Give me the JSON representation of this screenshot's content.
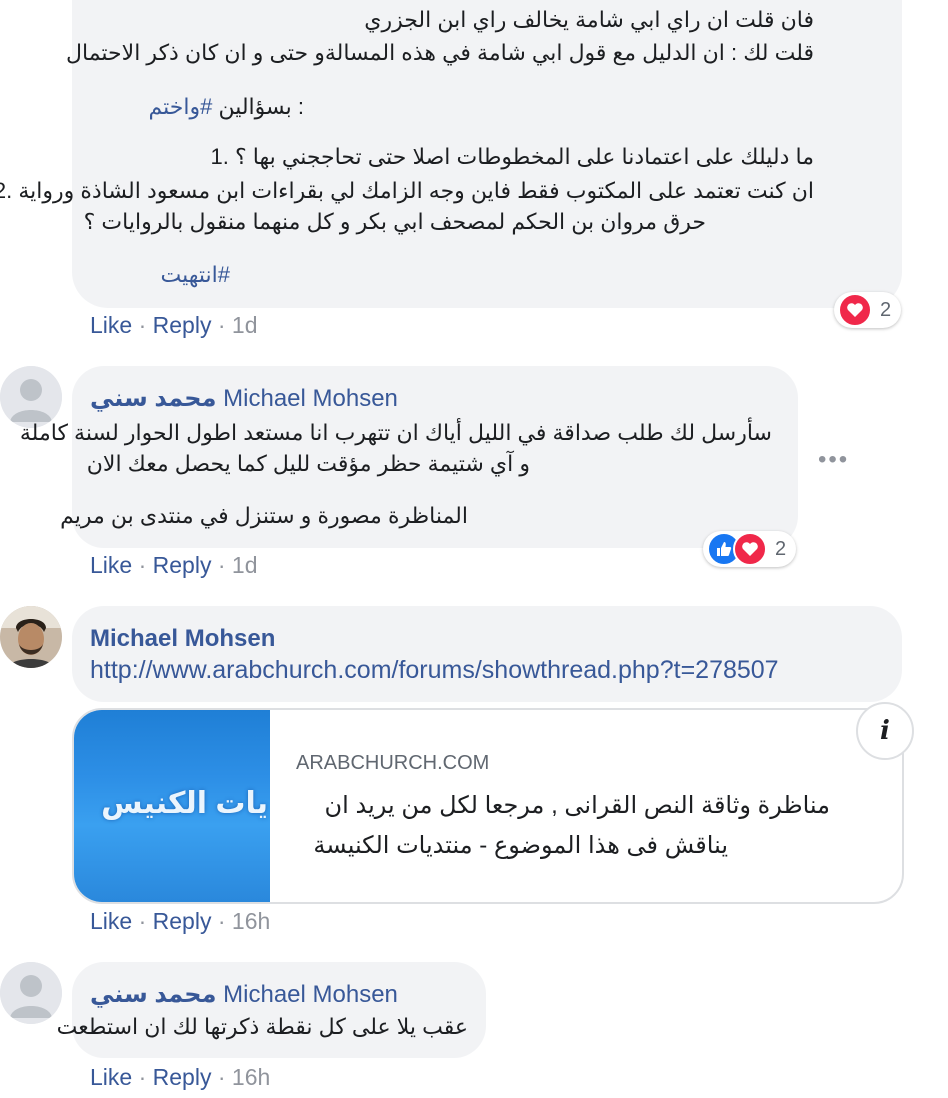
{
  "comment1": {
    "lines": [
      "فان قلت ان راي ابي شامة يخالف راي ابن الجزري",
      "قلت لك : ان الدليل مع قول ابي شامة في هذه المسالةو حتى و ان كان ذكر الاحتمال"
    ],
    "question_prefix": ": بسؤالين ",
    "question_hashtag": "#واختم",
    "item1": "ما دليلك على اعتمادنا على المخطوطات اصلا حتى تحاججني بها ؟ .1",
    "item2a": "ان كنت تعتمد على المكتوب فقط فاين وجه الزامك لي بقراءات ابن مسعود الشاذة ورواية .2",
    "item2b": "حرق مروان بن الحكم لمصحف ابي بكر و كل منهما منقول بالروايات ؟",
    "end_hashtag": "#انتهيت",
    "actions": {
      "like": "Like",
      "reply": "Reply",
      "time": "1d"
    },
    "reaction_count": "2"
  },
  "comment2": {
    "author": "محمد سني",
    "tagged": "Michael Mohsen",
    "lines": [
      "سأرسل لك طلب صداقة في الليل أياك ان تتهرب انا مستعد اطول الحوار لسنة كاملة",
      "و آي شتيمة حظر مؤقت لليل كما يحصل معك الان",
      "المناظرة مصورة و ستنزل في منتدى بن مريم"
    ],
    "more": "•••",
    "actions": {
      "like": "Like",
      "reply": "Reply",
      "time": "1d"
    },
    "reaction_count": "2"
  },
  "comment3": {
    "author": "Michael Mohsen",
    "url": "http://www.arabchurch.com/forums/showthread.php?t=278507",
    "preview": {
      "domain": "ARABCHURCH.COM",
      "title_line1": "مناظرة وثاقة النص القرانى , مرجعا لكل من يريد ان",
      "title_line2": "يناقش فى هذا الموضوع - منتديات الكنيسة",
      "image_text": "يات الكنيس",
      "info": "i"
    },
    "actions": {
      "like": "Like",
      "reply": "Reply",
      "time": "16h"
    }
  },
  "comment4": {
    "author": "محمد سني",
    "tagged": "Michael Mohsen",
    "lines": [
      "عقب يلا على كل نقطة ذكرتها لك ان استطعت"
    ],
    "actions": {
      "like": "Like",
      "reply": "Reply",
      "time": "16h"
    }
  },
  "separator": " · ",
  "colors": {
    "link": "#385898",
    "bubble": "#f2f3f5",
    "love": "#f0284a",
    "like": "#1877f2"
  },
  "icons": {
    "love": "heart-icon",
    "like": "thumbs-up-icon",
    "avatar": "default-avatar-icon"
  }
}
